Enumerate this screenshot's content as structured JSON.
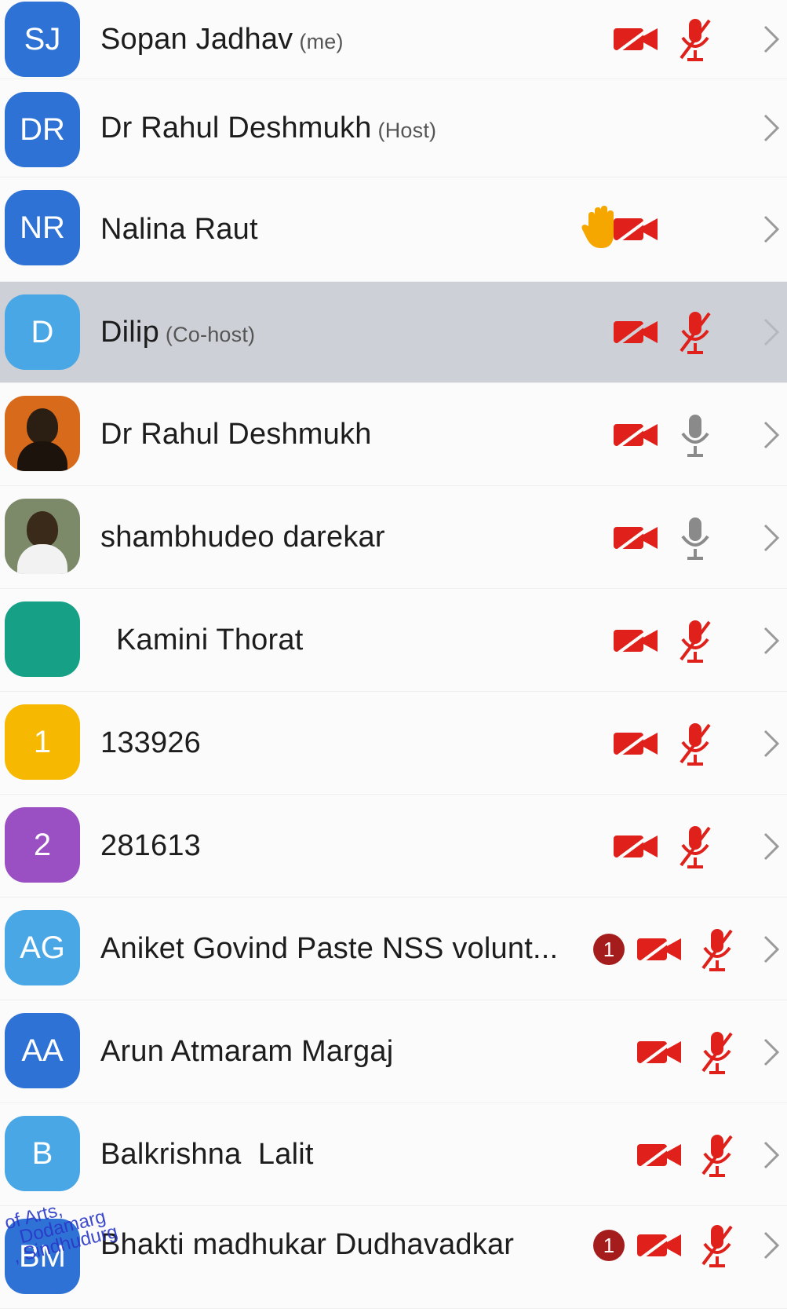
{
  "participants": [
    {
      "initials": "SJ",
      "name": "Sopan Jadhav",
      "tag": "(me)",
      "avatar_color": "#2f72d6"
    },
    {
      "initials": "DR",
      "name": "Dr Rahul Deshmukh",
      "tag": "(Host)",
      "avatar_color": "#2f72d6"
    },
    {
      "initials": "NR",
      "name": "Nalina Raut",
      "tag": "",
      "avatar_color": "#2f72d6"
    },
    {
      "initials": "D",
      "name": "Dilip",
      "tag": "(Co-host)",
      "avatar_color": "#49a7e6"
    },
    {
      "initials": "",
      "name": "Dr Rahul Deshmukh",
      "tag": "",
      "avatar_color": "#d86a1c"
    },
    {
      "initials": "",
      "name": "shambhudeo darekar",
      "tag": "",
      "avatar_color": "#7c8a6a"
    },
    {
      "initials": "",
      "name": "Kamini Thorat",
      "tag": "",
      "avatar_color": "#16a085"
    },
    {
      "initials": "1",
      "name": "133926",
      "tag": "",
      "avatar_color": "#f6b800"
    },
    {
      "initials": "2",
      "name": "281613",
      "tag": "",
      "avatar_color": "#9a4fc3"
    },
    {
      "initials": "AG",
      "name": "Aniket Govind Paste NSS volunt...",
      "tag": "",
      "avatar_color": "#49a7e6",
      "unread": "1"
    },
    {
      "initials": "AA",
      "name": "Arun Atmaram Margaj",
      "tag": "",
      "avatar_color": "#2f72d6"
    },
    {
      "initials": "B",
      "name": "Balkrishna  Lalit",
      "tag": "",
      "avatar_color": "#49a7e6"
    },
    {
      "initials": "BM",
      "name": "Bhakti madhukar Dudhavadkar",
      "tag": "",
      "avatar_color": "#2f72d6",
      "unread": "1"
    }
  ],
  "stamp": {
    "line1": "of Arts,",
    "line2": "Dodamarg",
    "line3": ", Sindhudurg"
  },
  "colors": {
    "muted_red": "#e0201a",
    "mic_gray": "#8a8a8a",
    "hand": "#f5a700",
    "selected_row": "#cdd0d6"
  }
}
